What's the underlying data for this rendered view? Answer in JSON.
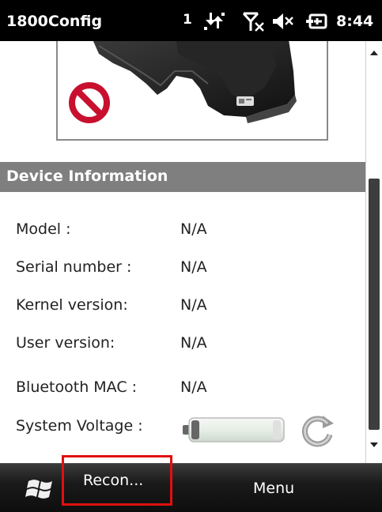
{
  "status_bar": {
    "app_title": "1800Config",
    "notification_count": "1",
    "icons": [
      "data-transfer-icon",
      "no-signal-icon",
      "volume-muted-icon",
      "power-plug-icon"
    ],
    "clock": "8:44"
  },
  "device_image": {
    "icons": [
      "scanner-image",
      "prohibited-icon"
    ],
    "device_logo": "CipherLab"
  },
  "device_information": {
    "section_title": "Device Information",
    "rows": [
      {
        "label": "Model :",
        "value": "N/A"
      },
      {
        "label": "Serial number :",
        "value": "N/A"
      },
      {
        "label": "Kernel version:",
        "value": "N/A"
      },
      {
        "label": "User version:",
        "value": "N/A"
      },
      {
        "label": "Bluetooth MAC :",
        "value": "N/A"
      }
    ],
    "system_voltage_label": "System Voltage :",
    "battery_level": 0.1,
    "refresh_icon": "refresh-icon"
  },
  "softkeys": {
    "start_icon": "windows-flag-icon",
    "left_label": "Recon...",
    "right_label": "Menu"
  },
  "colors": {
    "section_header": "#7f7f7f",
    "highlight_border": "#e01010",
    "prohibited_red": "#c8102e"
  }
}
